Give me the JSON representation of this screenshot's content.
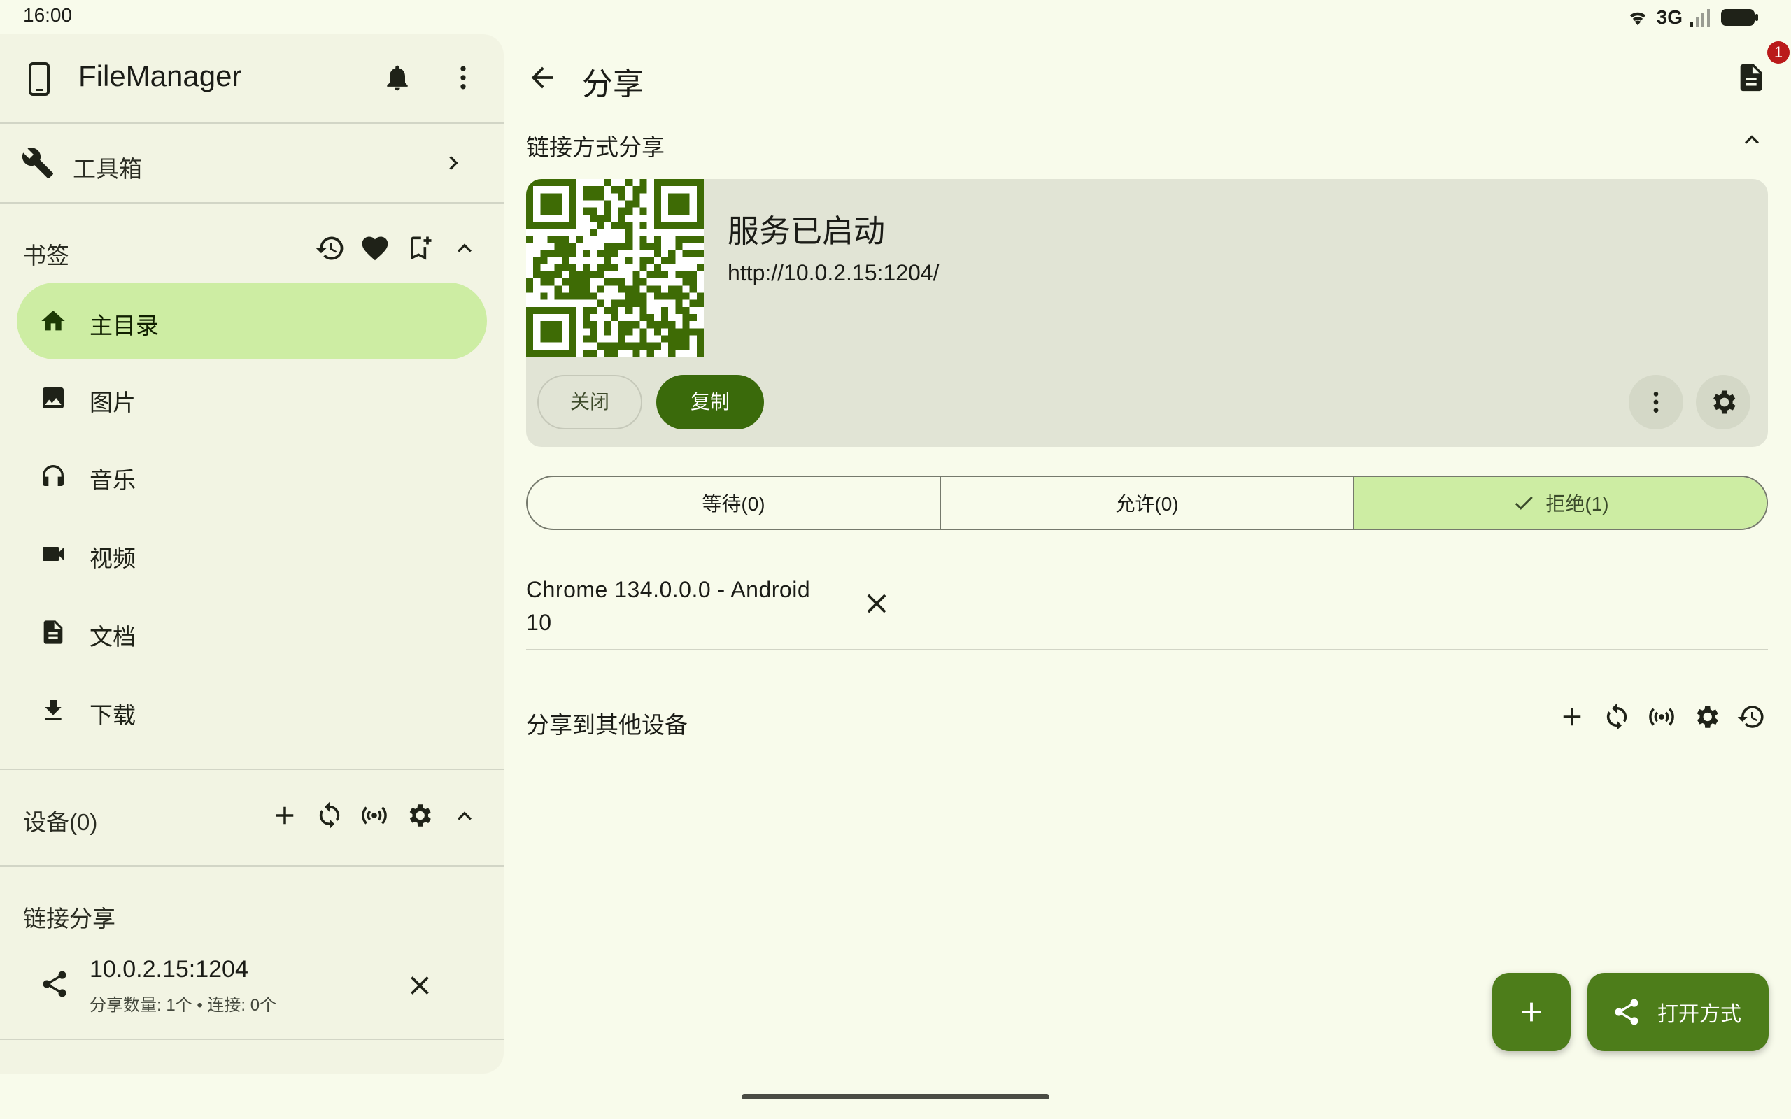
{
  "status_bar": {
    "time": "16:00",
    "network": "3G"
  },
  "drawer": {
    "app_title": "FileManager",
    "toolbox_label": "工具箱",
    "bookmarks_label": "书签",
    "nav_items": [
      {
        "label": "主目录",
        "icon": "home-icon",
        "active": true
      },
      {
        "label": "图片",
        "icon": "image-icon"
      },
      {
        "label": "音乐",
        "icon": "headphones-icon"
      },
      {
        "label": "视频",
        "icon": "videocam-icon"
      },
      {
        "label": "文档",
        "icon": "document-icon"
      },
      {
        "label": "下载",
        "icon": "download-icon"
      }
    ],
    "devices_label": "设备(0)",
    "link_share_label": "链接分享",
    "share_entry": {
      "host": "10.0.2.15:1204",
      "meta": "分享数量: 1个 • 连接: 0个"
    }
  },
  "main": {
    "title": "分享",
    "badge_count": "1",
    "section_title": "链接方式分享",
    "service": {
      "status": "服务已启动",
      "url": "http://10.0.2.15:1204/",
      "close_label": "关闭",
      "copy_label": "复制"
    },
    "tabs": [
      {
        "label": "等待(0)"
      },
      {
        "label": "允许(0)"
      },
      {
        "label": "拒绝(1)",
        "selected": true
      }
    ],
    "clients": [
      {
        "name": "Chrome 134.0.0.0 - Android 10"
      }
    ],
    "other_devices_title": "分享到其他设备",
    "fab_open_label": "打开方式"
  },
  "colors": {
    "accent": "#4d7d1a",
    "selected": "#cdeda3",
    "background": "#f8fbeb",
    "badge": "#ba1a1a"
  }
}
